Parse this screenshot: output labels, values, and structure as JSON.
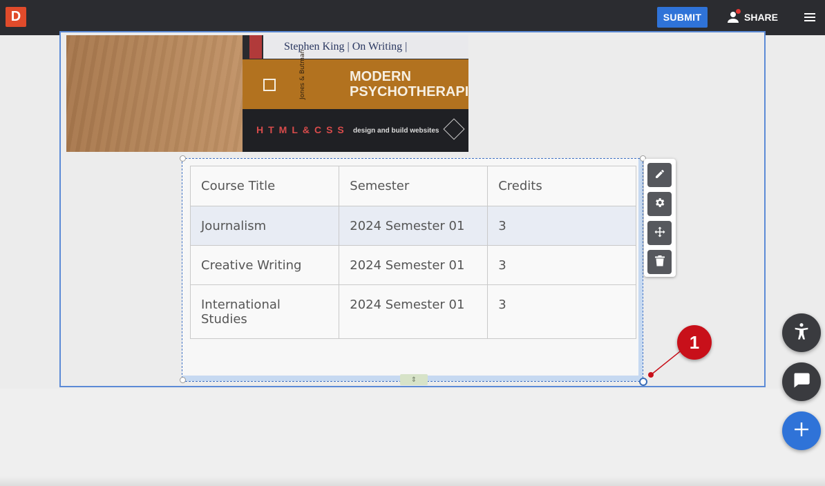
{
  "app": {
    "logo_letter": "D"
  },
  "topbar": {
    "submit_label": "SUBMIT",
    "share_label": "SHARE"
  },
  "image": {
    "book1_title": "Stephen King | On Writing |",
    "book2_title_line1": "MODERN",
    "book2_title_line2": "PSYCHOTHERAPI",
    "book2_author": "Jones & Butman",
    "book3_left": "HTML&CSS",
    "book3_title": "design and build websites"
  },
  "table": {
    "headers": [
      "Course Title",
      "Semester",
      "Credits"
    ],
    "rows": [
      [
        "Journalism",
        "2024 Semester 01",
        "3"
      ],
      [
        "Creative Writing",
        "2024 Semester 01",
        "3"
      ],
      [
        "International Studies",
        "2024 Semester 01",
        "3"
      ]
    ]
  },
  "toolbar": {
    "items": [
      "pencil-icon",
      "gear-icon",
      "move-icon",
      "trash-icon"
    ]
  },
  "annotation": {
    "number": "1",
    "color": "#c8101a"
  },
  "colors": {
    "accent": "#2f73d8",
    "topbar": "#2b2c30",
    "selection": "#3c6fc4"
  }
}
